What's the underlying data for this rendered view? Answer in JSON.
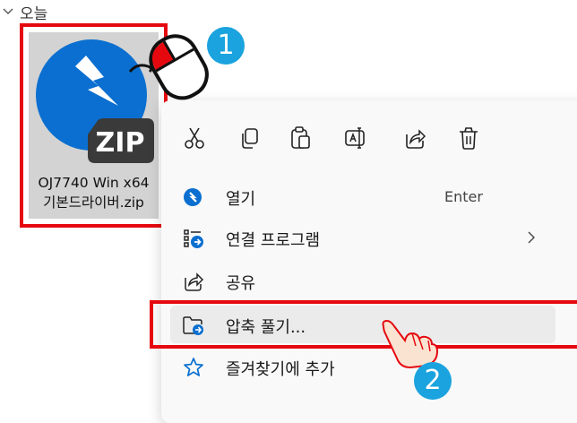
{
  "group": {
    "label": "오늘",
    "icon": "chevron-down-icon"
  },
  "file": {
    "icon": "zip-file-icon",
    "icon_text": "ZIP",
    "name_line1": "OJ7740 Win x64",
    "name_line2": "기본드라이버.zip"
  },
  "annotations": {
    "step1": "1",
    "step2": "2"
  },
  "context_menu": {
    "toolbar": [
      "cut-icon",
      "copy-icon",
      "paste-icon",
      "rename-icon",
      "share-icon",
      "delete-icon"
    ],
    "items": [
      {
        "icon": "open-icon",
        "label": "열기",
        "accelerator": "Enter"
      },
      {
        "icon": "open-with-icon",
        "label": "연결 프로그램",
        "submenu": true
      },
      {
        "icon": "share-icon",
        "label": "공유"
      },
      {
        "icon": "extract-icon",
        "label": "압축 풀기..."
      },
      {
        "icon": "star-icon",
        "label": "즐겨찾기에 추가"
      }
    ]
  },
  "colors": {
    "highlight": "#e5090f",
    "badge": "#1aa3de",
    "accent": "#0067c0"
  }
}
